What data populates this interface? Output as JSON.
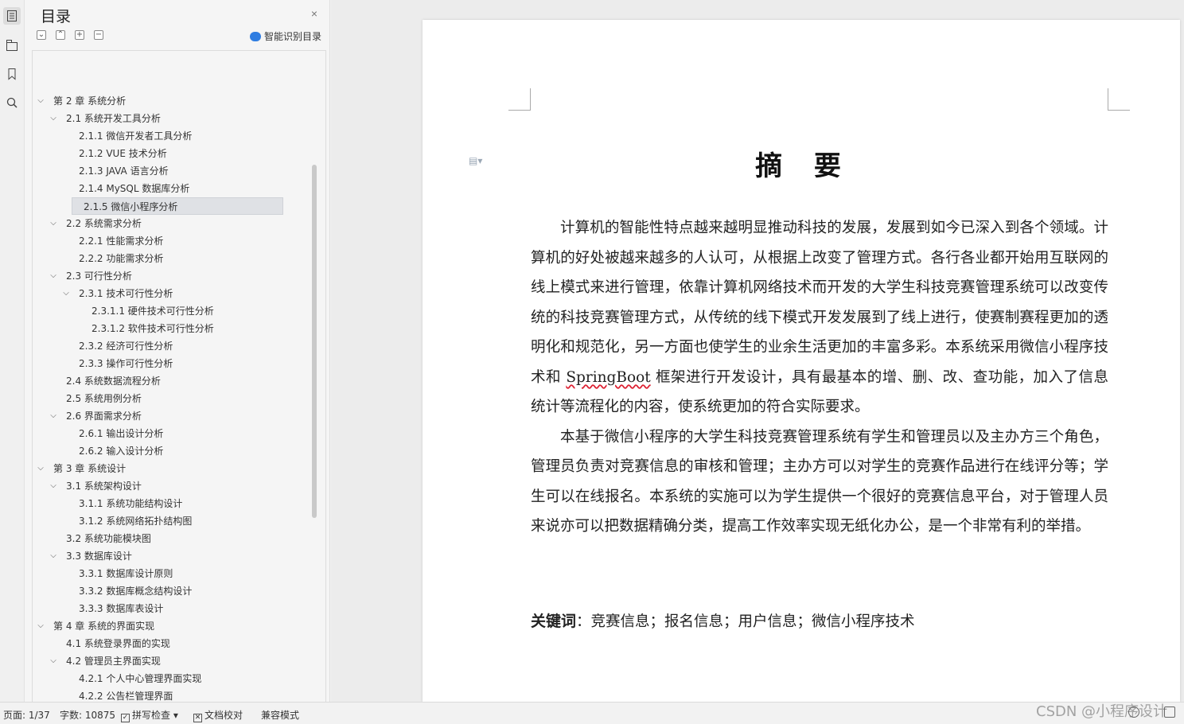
{
  "toc": {
    "title": "目录",
    "close_glyph": "×",
    "tools": [
      "⌄",
      "⌃",
      "+",
      "−"
    ],
    "smart_label": "智能识别目录",
    "items": [
      {
        "label": "第 2 章  系统分析",
        "level": 1,
        "expand": "open"
      },
      {
        "label": "2.1  系统开发工具分析",
        "level": 2,
        "expand": "open"
      },
      {
        "label": "2.1.1  微信开发者工具分析",
        "level": 3
      },
      {
        "label": "2.1.2 VUE 技术分析",
        "level": 3
      },
      {
        "label": "2.1.3 JAVA 语言分析",
        "level": 3
      },
      {
        "label": "2.1.4 MySQL 数据库分析",
        "level": 3
      },
      {
        "label": "2.1.5 微信小程序分析",
        "level": 3,
        "selected": true
      },
      {
        "label": "2.2 系统需求分析",
        "level": 2,
        "expand": "open"
      },
      {
        "label": "2.2.1  性能需求分析",
        "level": 3
      },
      {
        "label": "2.2.2  功能需求分析",
        "level": 3
      },
      {
        "label": "2.3 可行性分析",
        "level": 2,
        "expand": "open"
      },
      {
        "label": "2.3.1  技术可行性分析",
        "level": 3,
        "expand": "open"
      },
      {
        "label": "2.3.1.1 硬件技术可行性分析",
        "level": 4
      },
      {
        "label": "2.3.1.2 软件技术可行性分析",
        "level": 4
      },
      {
        "label": "2.3.2  经济可行性分析",
        "level": 3
      },
      {
        "label": "2.3.3  操作可行性分析",
        "level": 3
      },
      {
        "label": "2.4  系统数据流程分析",
        "level": 2
      },
      {
        "label": "2.5 系统用例分析",
        "level": 2
      },
      {
        "label": "2.6  界面需求分析",
        "level": 2,
        "expand": "open"
      },
      {
        "label": "2.6.1 输出设计分析",
        "level": 3
      },
      {
        "label": "2.6.2 输入设计分析",
        "level": 3
      },
      {
        "label": "第 3 章  系统设计",
        "level": 1,
        "expand": "open"
      },
      {
        "label": "3.1  系统架构设计",
        "level": 2,
        "expand": "open"
      },
      {
        "label": "3.1.1  系统功能结构设计",
        "level": 3
      },
      {
        "label": "3.1.2 系统网络拓扑结构图",
        "level": 3
      },
      {
        "label": "3.2  系统功能模块图",
        "level": 2
      },
      {
        "label": "3.3 数据库设计",
        "level": 2,
        "expand": "open"
      },
      {
        "label": "3.3.1 数据库设计原则",
        "level": 3
      },
      {
        "label": "3.3.2  数据库概念结构设计",
        "level": 3
      },
      {
        "label": "3.3.3  数据库表设计",
        "level": 3
      },
      {
        "label": "第 4 章  系统的界面实现",
        "level": 1,
        "expand": "open"
      },
      {
        "label": "4.1 系统登录界面的实现",
        "level": 2
      },
      {
        "label": "4.2 管理员主界面实现",
        "level": 2,
        "expand": "open"
      },
      {
        "label": "4.2.1 个人中心管理界面实现",
        "level": 3
      },
      {
        "label": "4.2.2 公告栏管理界面",
        "level": 3
      }
    ]
  },
  "document": {
    "title": "摘 要",
    "paragraph1_a": "计算机的智能性特点越来越明显推动科技的发展，发展到如今已深入到各个领域。计算机的好处被越来越多的人认可，从根据上改变了管理方式。各行各业都开始用互联网的线上模式来进行管理，依靠计算机网络技术而开发的大学生科技竞赛管理系统可以改变传统的科技竞赛管理方式，从传统的线下模式开发发展到了线上进行，使赛制赛程更加的透明化和规范化，另一方面也使学生的业余生活更加的丰富多彩。本系统采用微信小程序技术和 ",
    "paragraph1_word": "SpringBoot",
    "paragraph1_b": " 框架进行开发设计，具有最基本的增、删、改、查功能，加入了信息统计等流程化的内容，使系统更加的符合实际要求。",
    "paragraph2": "本基于微信小程序的大学生科技竞赛管理系统有学生和管理员以及主办方三个角色，管理员负责对竞赛信息的审核和管理；主办方可以对学生的竞赛作品进行在线评分等；学生可以在线报名。本系统的实施可以为学生提供一个很好的竞赛信息平台，对于管理人员来说亦可以把数据精确分类，提高工作效率实现无纸化办公，是一个非常有利的举措。",
    "keywords_label": "关键词",
    "keywords_value": "：竞赛信息；报名信息；用户信息；微信小程序技术"
  },
  "status": {
    "page": "页面: 1/37",
    "words": "字数: 10875",
    "spellcheck": "拼写检查",
    "spellcheck_caret": "▾",
    "proofread": "文档校对",
    "compat": "兼容模式"
  },
  "watermark": "CSDN @小程序设计"
}
